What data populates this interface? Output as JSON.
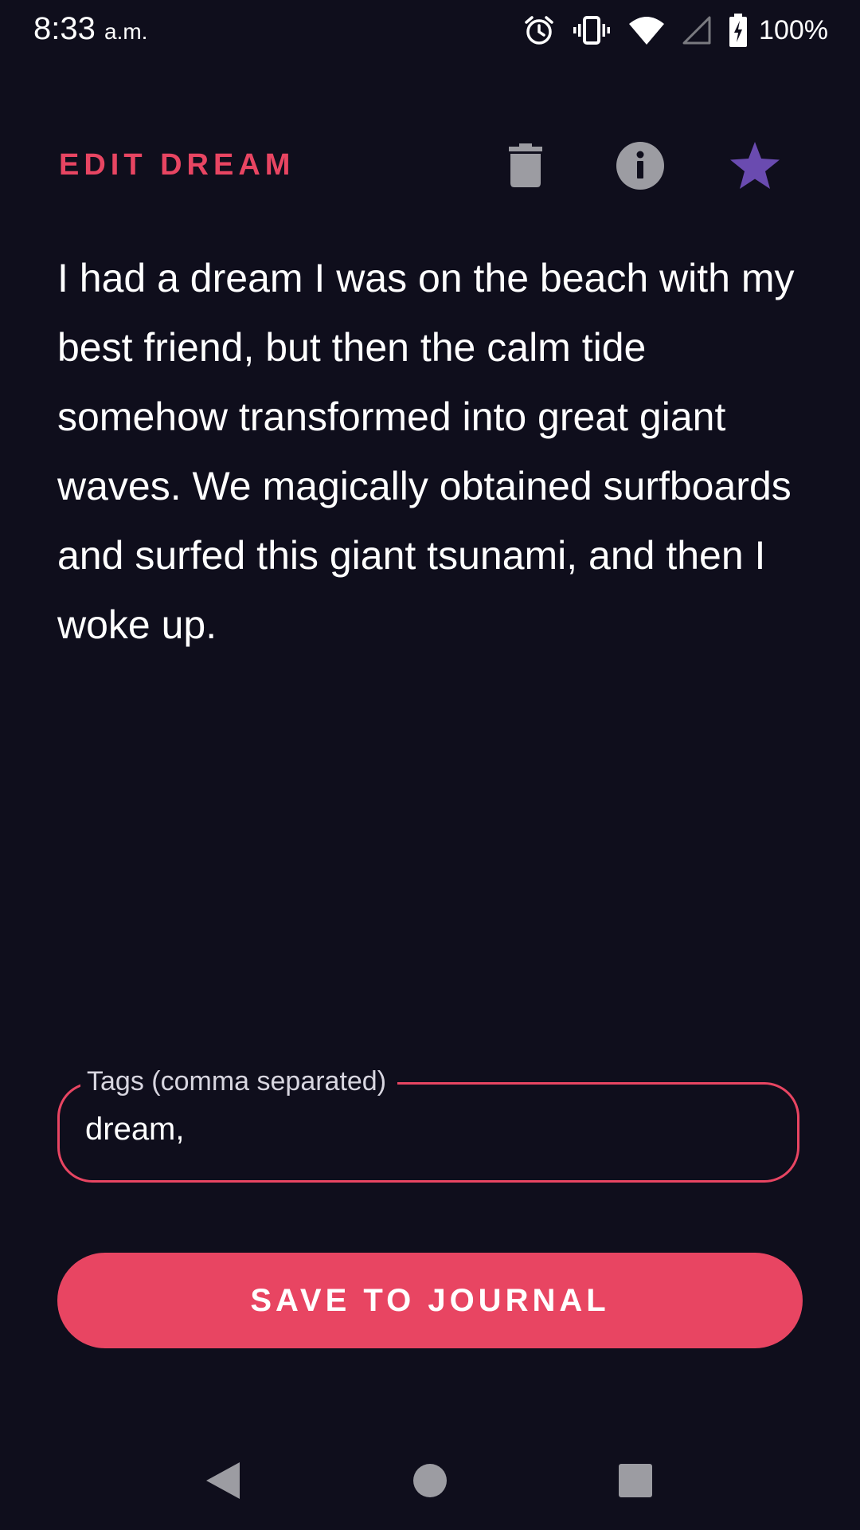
{
  "status_bar": {
    "time": "8:33",
    "ampm": "a.m.",
    "battery": "100%",
    "icons": [
      "alarm-icon",
      "vibrate-icon",
      "wifi-icon",
      "cell-signal-icon",
      "battery-charging-icon"
    ]
  },
  "header": {
    "title": "EDIT DREAM",
    "actions": [
      "trash-icon",
      "info-icon",
      "star-icon"
    ]
  },
  "dream": {
    "text": "I had a dream I was on the beach with my best friend, but then the calm tide somehow transformed into great giant waves. We magically obtained surfboards and surfed this giant tsunami, and then I woke up."
  },
  "tags": {
    "label": "Tags (comma separated)",
    "value": "dream,"
  },
  "save_button": {
    "label": "SAVE TO JOURNAL"
  },
  "nav": {
    "icons": [
      "back-icon",
      "home-icon",
      "recents-icon"
    ]
  },
  "colors": {
    "background": "#0f0e1c",
    "accent": "#e84562",
    "star": "#6a4bb0",
    "icon_gray": "#9c9ca2"
  }
}
